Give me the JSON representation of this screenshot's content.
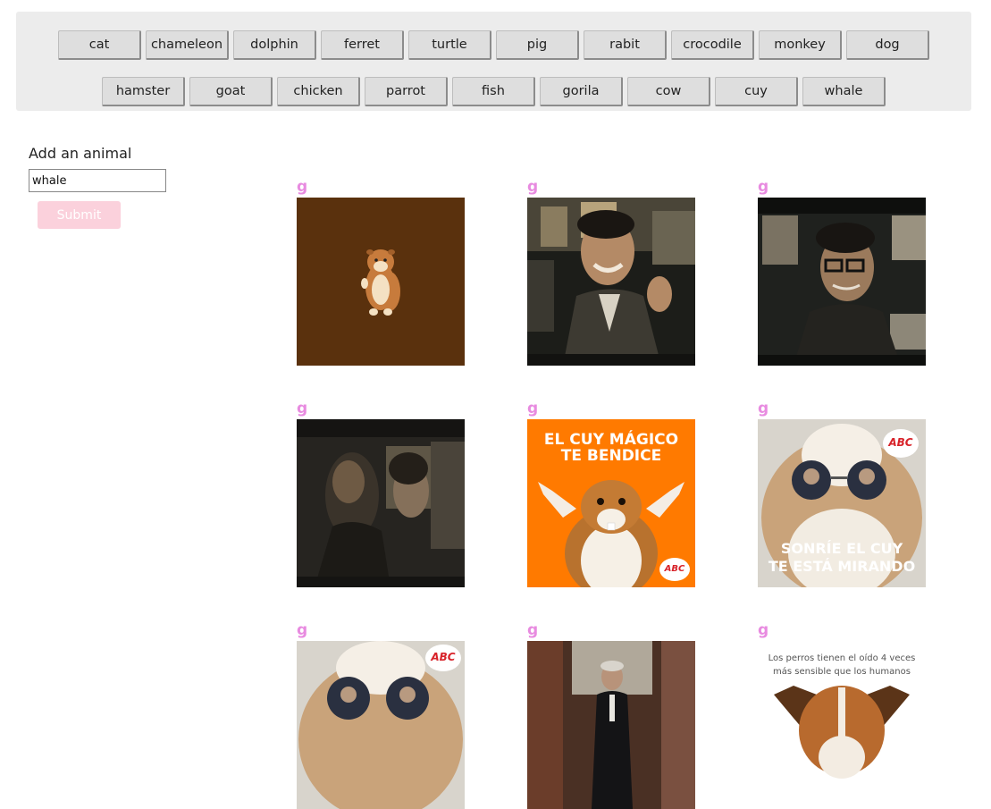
{
  "buttons_row1": [
    "cat",
    "chameleon",
    "dolphin",
    "ferret",
    "turtle",
    "pig",
    "rabit",
    "crocodile",
    "monkey",
    "dog"
  ],
  "buttons_row2": [
    "hamster",
    "goat",
    "chicken",
    "parrot",
    "fish",
    "gorila",
    "cow",
    "cuy",
    "whale"
  ],
  "form": {
    "label": "Add an animal",
    "input_value": "whale",
    "submit_label": "Submit"
  },
  "gifs": [
    {
      "rating": "g",
      "caption": ""
    },
    {
      "rating": "g",
      "caption": ""
    },
    {
      "rating": "g",
      "caption": ""
    },
    {
      "rating": "g",
      "caption": ""
    },
    {
      "rating": "g",
      "caption_line1": "EL CUY MÁGICO",
      "caption_line2": "TE BENDICE",
      "logo": "ABC"
    },
    {
      "rating": "g",
      "caption_line1": "SONRÍE EL CUY",
      "caption_line2": "TE ESTÁ MIRANDO",
      "logo": "ABC"
    },
    {
      "rating": "g",
      "logo": "ABC"
    },
    {
      "rating": "g",
      "caption": ""
    },
    {
      "rating": "g",
      "caption_line1": "Los perros tienen el oído 4 veces",
      "caption_line2": "más sensible que los humanos"
    }
  ],
  "colors": {
    "rating": "#e88be0",
    "submit_bg": "#fbd1dc",
    "bar_bg": "#ececec",
    "orange": "#ff7a00"
  }
}
